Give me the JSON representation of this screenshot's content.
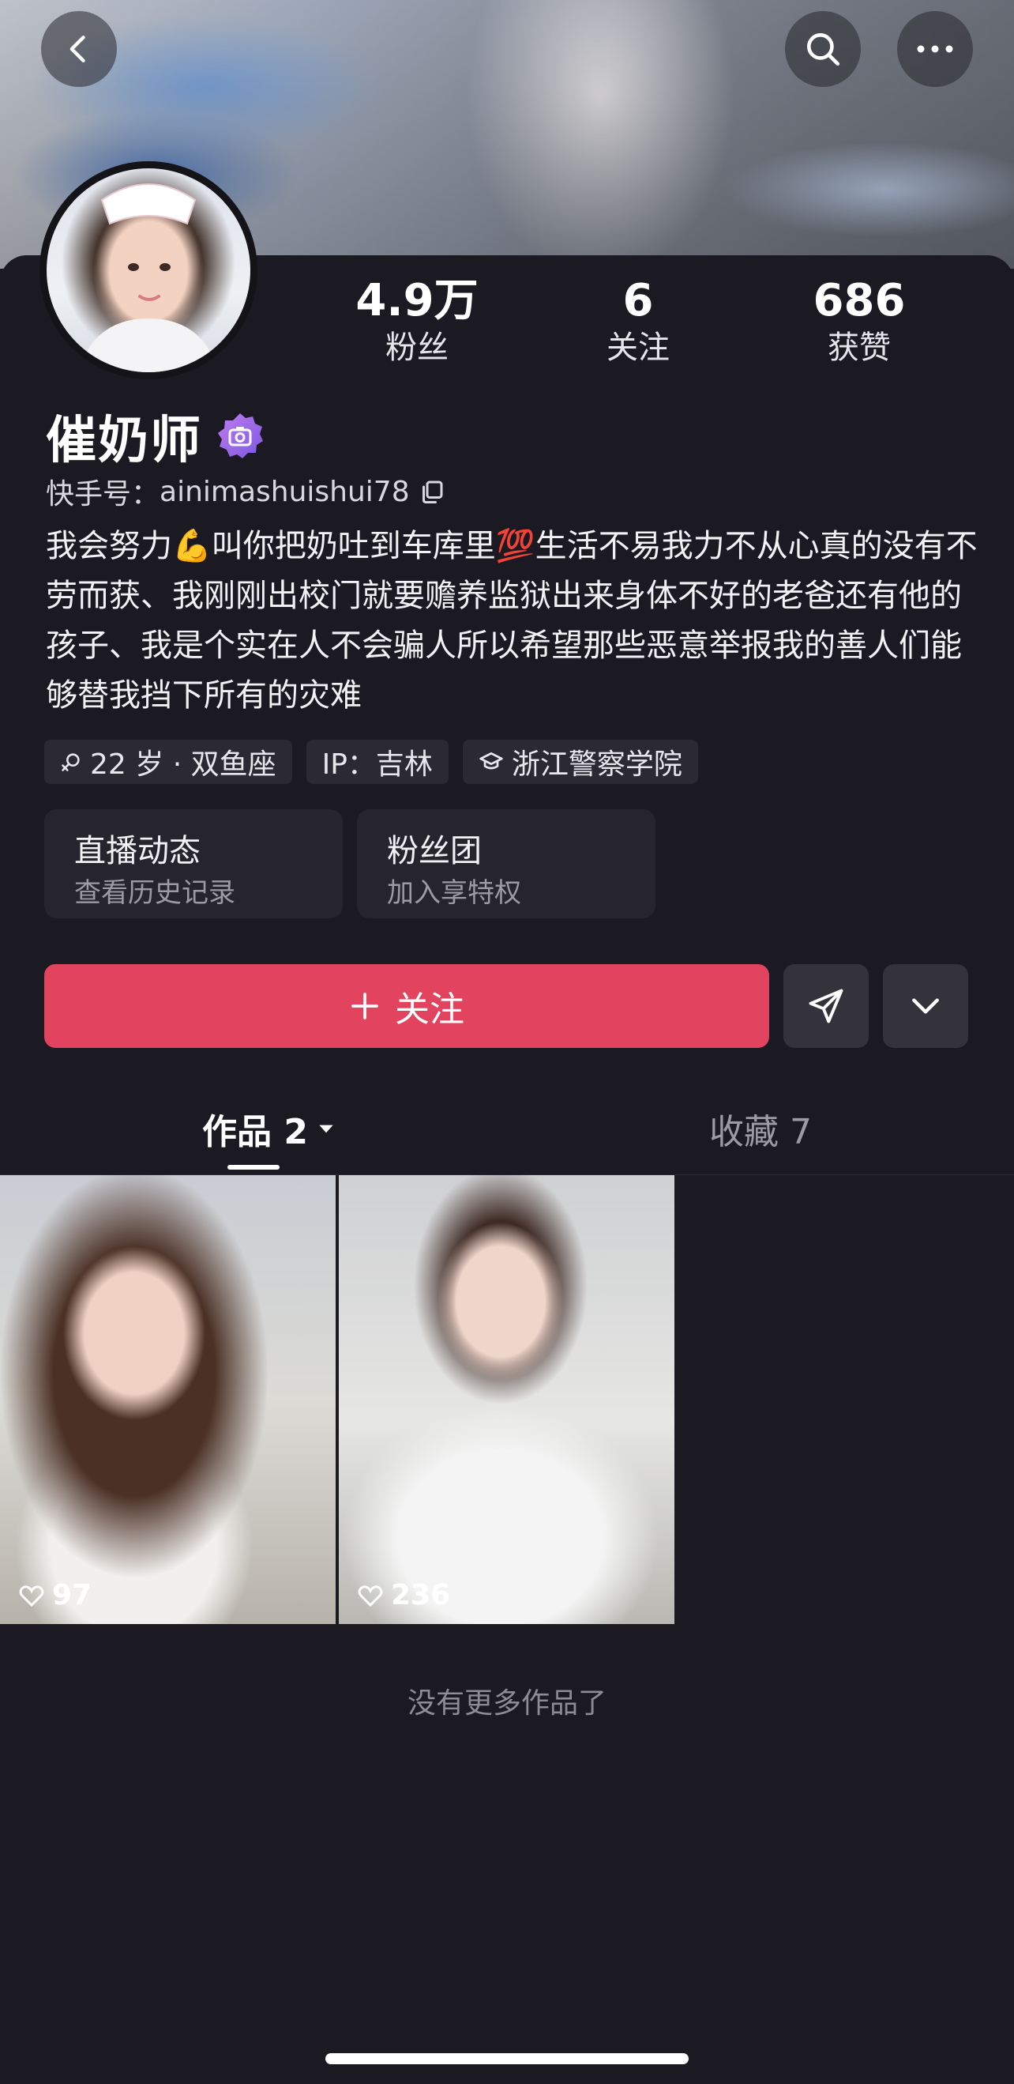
{
  "header": {
    "back_icon": "chevron-left-icon",
    "search_icon": "search-icon",
    "more_icon": "more-horizontal-icon"
  },
  "stats": [
    {
      "value": "4.9万",
      "label": "粉丝"
    },
    {
      "value": "6",
      "label": "关注"
    },
    {
      "value": "686",
      "label": "获赞"
    }
  ],
  "profile": {
    "name": "催奶师",
    "uid_label": "快手号：",
    "uid": "ainimashuishui78",
    "bio": "我会努力💪叫你把奶吐到车库里💯生活不易我力不从心真的没有不劳而获、我刚刚出校门就要赡养监狱出来身体不好的老爸还有他的孩子、我是个实在人不会骗人所以希望那些恶意举报我的善人们能够替我挡下所有的灾难"
  },
  "tags": [
    {
      "icon": "female-icon",
      "text": "22 岁 · 双鱼座"
    },
    {
      "text": "IP：吉林"
    },
    {
      "icon": "graduation-cap-icon",
      "text": "浙江警察学院"
    }
  ],
  "cards": [
    {
      "title": "直播动态",
      "subtitle": "查看历史记录"
    },
    {
      "title": "粉丝团",
      "subtitle": "加入享特权"
    }
  ],
  "actions": {
    "follow_label": "关注",
    "share_icon": "send-icon",
    "expand_icon": "chevron-down-icon"
  },
  "tabs": [
    {
      "label": "作品 2",
      "active": true
    },
    {
      "label": "收藏 7",
      "active": false
    }
  ],
  "videos": [
    {
      "likes": "97"
    },
    {
      "likes": "236"
    }
  ],
  "footer": {
    "no_more": "没有更多作品了"
  },
  "colors": {
    "background": "#1b1a22",
    "accent": "#e2435e",
    "tag_bg": "#2b2a32"
  }
}
